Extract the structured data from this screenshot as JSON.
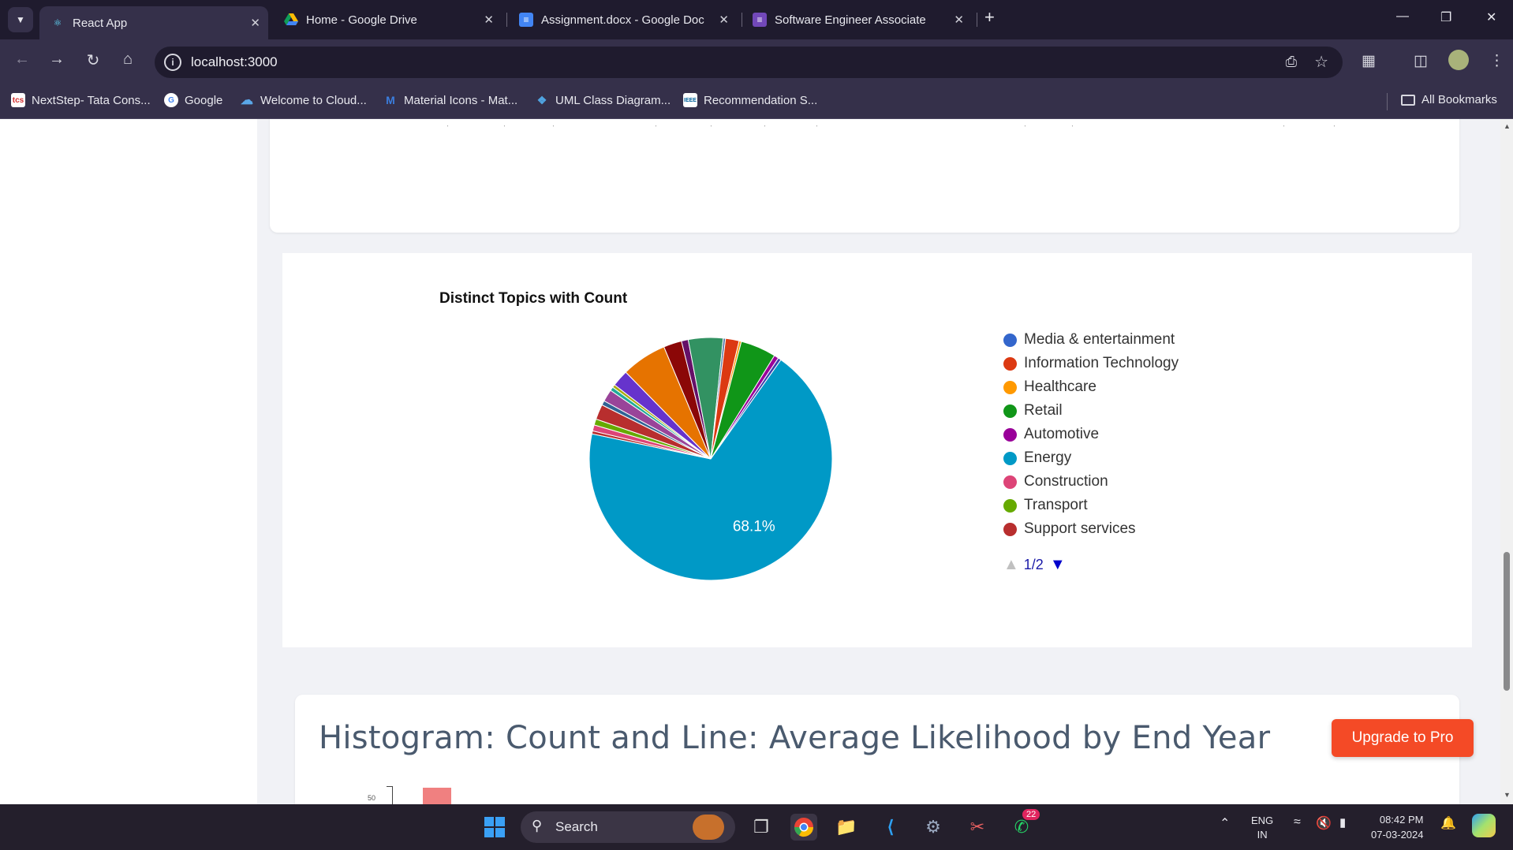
{
  "browser": {
    "tabs": [
      {
        "title": "React App",
        "icon": "react-icon"
      },
      {
        "title": "Home - Google Drive",
        "icon": "drive-icon"
      },
      {
        "title": "Assignment.docx - Google Doc",
        "icon": "docs-icon"
      },
      {
        "title": "Software Engineer Associate",
        "icon": "forms-icon"
      }
    ],
    "url": "localhost:3000",
    "bookmarks": [
      {
        "label": "NextStep- Tata Cons...",
        "icon": "tcs-icon"
      },
      {
        "label": "Google",
        "icon": "google-icon"
      },
      {
        "label": "Welcome to Cloud...",
        "icon": "cloud-icon"
      },
      {
        "label": "Material Icons - Mat...",
        "icon": "material-icon"
      },
      {
        "label": "UML Class Diagram...",
        "icon": "uml-icon"
      },
      {
        "label": "Recommendation S...",
        "icon": "ieee-icon"
      }
    ],
    "all_bookmarks": "All Bookmarks"
  },
  "chart_data": {
    "type": "pie",
    "title": "Distinct Topics with Count",
    "slices": [
      {
        "name": "Energy",
        "value": 68.1,
        "color": "#0099c6"
      },
      {
        "name": "",
        "value": 0.4,
        "color": "#b82e2e"
      },
      {
        "name": "",
        "value": 0.8,
        "color": "#dd4477"
      },
      {
        "name": "",
        "value": 0.8,
        "color": "#66aa00"
      },
      {
        "name": "",
        "value": 2.0,
        "color": "#b82e2e"
      },
      {
        "name": "",
        "value": 0.6,
        "color": "#316395"
      },
      {
        "name": "",
        "value": 1.6,
        "color": "#994499"
      },
      {
        "name": "",
        "value": 0.5,
        "color": "#22aa99"
      },
      {
        "name": "",
        "value": 0.4,
        "color": "#aaaa11"
      },
      {
        "name": "",
        "value": 2.2,
        "color": "#6633cc"
      },
      {
        "name": "",
        "value": 6.0,
        "color": "#e67300"
      },
      {
        "name": "",
        "value": 2.4,
        "color": "#8b0707"
      },
      {
        "name": "",
        "value": 0.9,
        "color": "#651067"
      },
      {
        "name": "",
        "value": 4.6,
        "color": "#329262"
      },
      {
        "name": "",
        "value": 0.3,
        "color": "#5574a6"
      },
      {
        "name": "Information Technology",
        "value": 1.8,
        "color": "#dc3912"
      },
      {
        "name": "Healthcare",
        "value": 0.3,
        "color": "#ff9900"
      },
      {
        "name": "Retail",
        "value": 4.7,
        "color": "#109618"
      },
      {
        "name": "Automotive",
        "value": 0.6,
        "color": "#990099"
      },
      {
        "name": "",
        "value": 0.4,
        "color": "#3b3eac"
      }
    ],
    "labels": [
      {
        "text": "68.1%"
      }
    ],
    "legend": [
      {
        "name": "Media & entertainment",
        "color": "#3366cc"
      },
      {
        "name": "Information Technology",
        "color": "#dc3912"
      },
      {
        "name": "Healthcare",
        "color": "#ff9900"
      },
      {
        "name": "Retail",
        "color": "#109618"
      },
      {
        "name": "Automotive",
        "color": "#990099"
      },
      {
        "name": "Energy",
        "color": "#0099c6"
      },
      {
        "name": "Construction",
        "color": "#dd4477"
      },
      {
        "name": "Transport",
        "color": "#66aa00"
      },
      {
        "name": "Support services",
        "color": "#b82e2e"
      }
    ],
    "legend_placement": "right",
    "legend_page": "1/2"
  },
  "histogram": {
    "title": "Histogram: Count and Line: Average Likelihood by End Year",
    "y_tick_visible": "50"
  },
  "upgrade_button": "Upgrade to Pro",
  "taskbar": {
    "search_label": "Search",
    "whatsapp_badge": "22",
    "lang": "ENG",
    "region": "IN",
    "time": "08:42 PM",
    "date": "07-03-2024"
  }
}
